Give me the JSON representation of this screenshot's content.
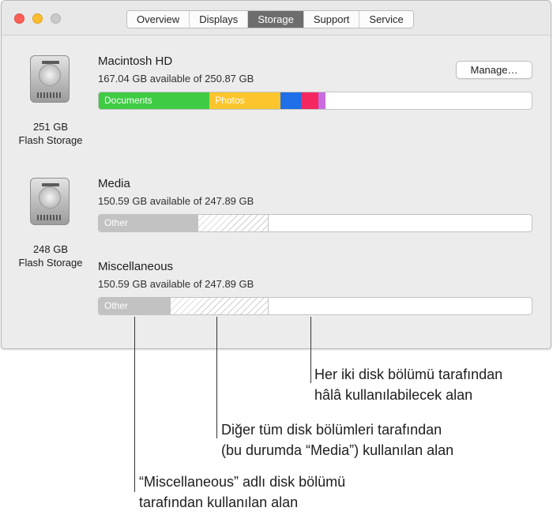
{
  "window": {
    "tabs": [
      {
        "label": "Overview"
      },
      {
        "label": "Displays"
      },
      {
        "label": "Storage"
      },
      {
        "label": "Support"
      },
      {
        "label": "Service"
      }
    ],
    "active_tab": "Storage"
  },
  "disks": [
    {
      "size": "251 GB",
      "type": "Flash Storage"
    },
    {
      "size": "248 GB",
      "type": "Flash Storage"
    }
  ],
  "volumes": [
    {
      "name": "Macintosh HD",
      "available": "167.04 GB available of 250.87 GB",
      "manage_label": "Manage…",
      "segments": [
        {
          "label": "Documents",
          "fraction": 0.256,
          "color": "#3fcb43"
        },
        {
          "label": "Photos",
          "fraction": 0.164,
          "color": "#fcc52e"
        },
        {
          "label": "",
          "fraction": 0.047,
          "color": "#1e6fe8"
        },
        {
          "label": "",
          "fraction": 0.04,
          "color": "#f4285f"
        },
        {
          "label": "",
          "fraction": 0.017,
          "color": "#c96ce0"
        }
      ]
    },
    {
      "name": "Media",
      "available": "150.59 GB available of 247.89 GB",
      "segments": [
        {
          "label": "Other",
          "fraction": 0.229,
          "color": "#c2c2c2"
        },
        {
          "label": "",
          "fraction": 0.164,
          "color": "hatch"
        }
      ]
    },
    {
      "name": "Miscellaneous",
      "available": "150.59 GB available of 247.89 GB",
      "segments": [
        {
          "label": "Other",
          "fraction": 0.164,
          "color": "#c2c2c2"
        },
        {
          "label": "",
          "fraction": 0.229,
          "color": "hatch"
        }
      ]
    }
  ],
  "callouts": [
    {
      "line1": "Her iki disk bölümü tarafından",
      "line2": "hâlâ kullanılabilecek alan"
    },
    {
      "line1": "Diğer tüm disk bölümleri tarafından",
      "line2": "(bu durumda “Media”) kullanılan alan"
    },
    {
      "line1": "“Miscellaneous” adlı disk bölümü",
      "line2": "tarafından kullanılan alan"
    }
  ]
}
